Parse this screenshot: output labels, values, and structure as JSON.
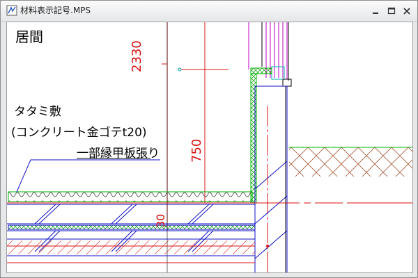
{
  "window": {
    "title": "材料表示記号.MPS"
  },
  "drawing": {
    "room_label": "居間",
    "note_line1": "タタミ敷",
    "note_line2": "(コンクリート金ゴテt20)",
    "note_line3": "一部縁甲板張り",
    "dim_2330": "2330",
    "dim_750": "750",
    "dim_30": "30"
  },
  "colors": {
    "red": "#d81010",
    "blue": "#1010c8",
    "green": "#00b000",
    "magenta": "#c000c0",
    "brown": "#a05028",
    "black": "#000000"
  }
}
